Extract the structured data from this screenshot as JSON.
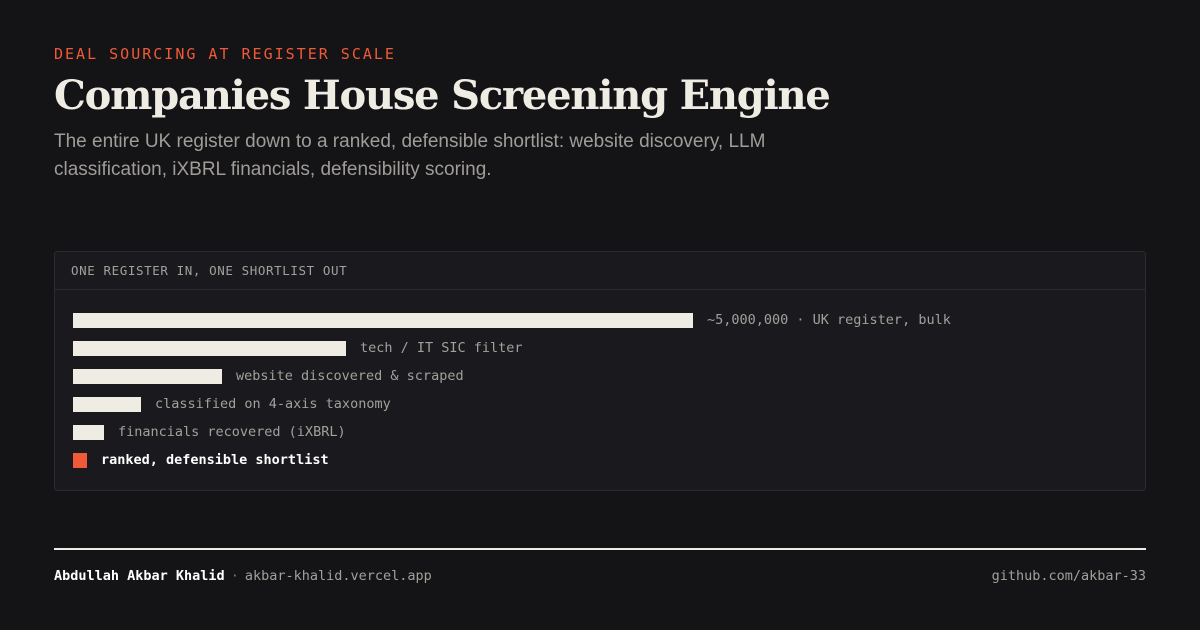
{
  "header": {
    "eyebrow": "DEAL SOURCING AT REGISTER SCALE",
    "title": "Companies House Screening Engine",
    "subtitle": "The entire UK register down to a ranked, defensible shortlist: website discovery, LLM classification, iXBRL financials, defensibility scoring."
  },
  "panel": {
    "title": "ONE REGISTER IN, ONE SHORTLIST OUT",
    "stages": [
      {
        "label": "~5,000,000 · UK register, bulk",
        "share": 1.0
      },
      {
        "label": "tech / IT SIC filter",
        "share": 0.44
      },
      {
        "label": "website discovered & scraped",
        "share": 0.24
      },
      {
        "label": "classified on 4-axis taxonomy",
        "share": 0.11
      },
      {
        "label": "financials recovered (iXBRL)",
        "share": 0.05
      },
      {
        "label": "ranked, defensible shortlist",
        "share": 0.022,
        "highlight": true
      }
    ]
  },
  "footer": {
    "author": "Abdullah Akbar Khalid",
    "separator": "·",
    "website": "akbar-khalid.vercel.app",
    "github": "github.com/akbar-33"
  },
  "colors": {
    "background": "#141417",
    "accent": "#f05a37",
    "text": "#efece4",
    "muted": "#a3a09a"
  }
}
